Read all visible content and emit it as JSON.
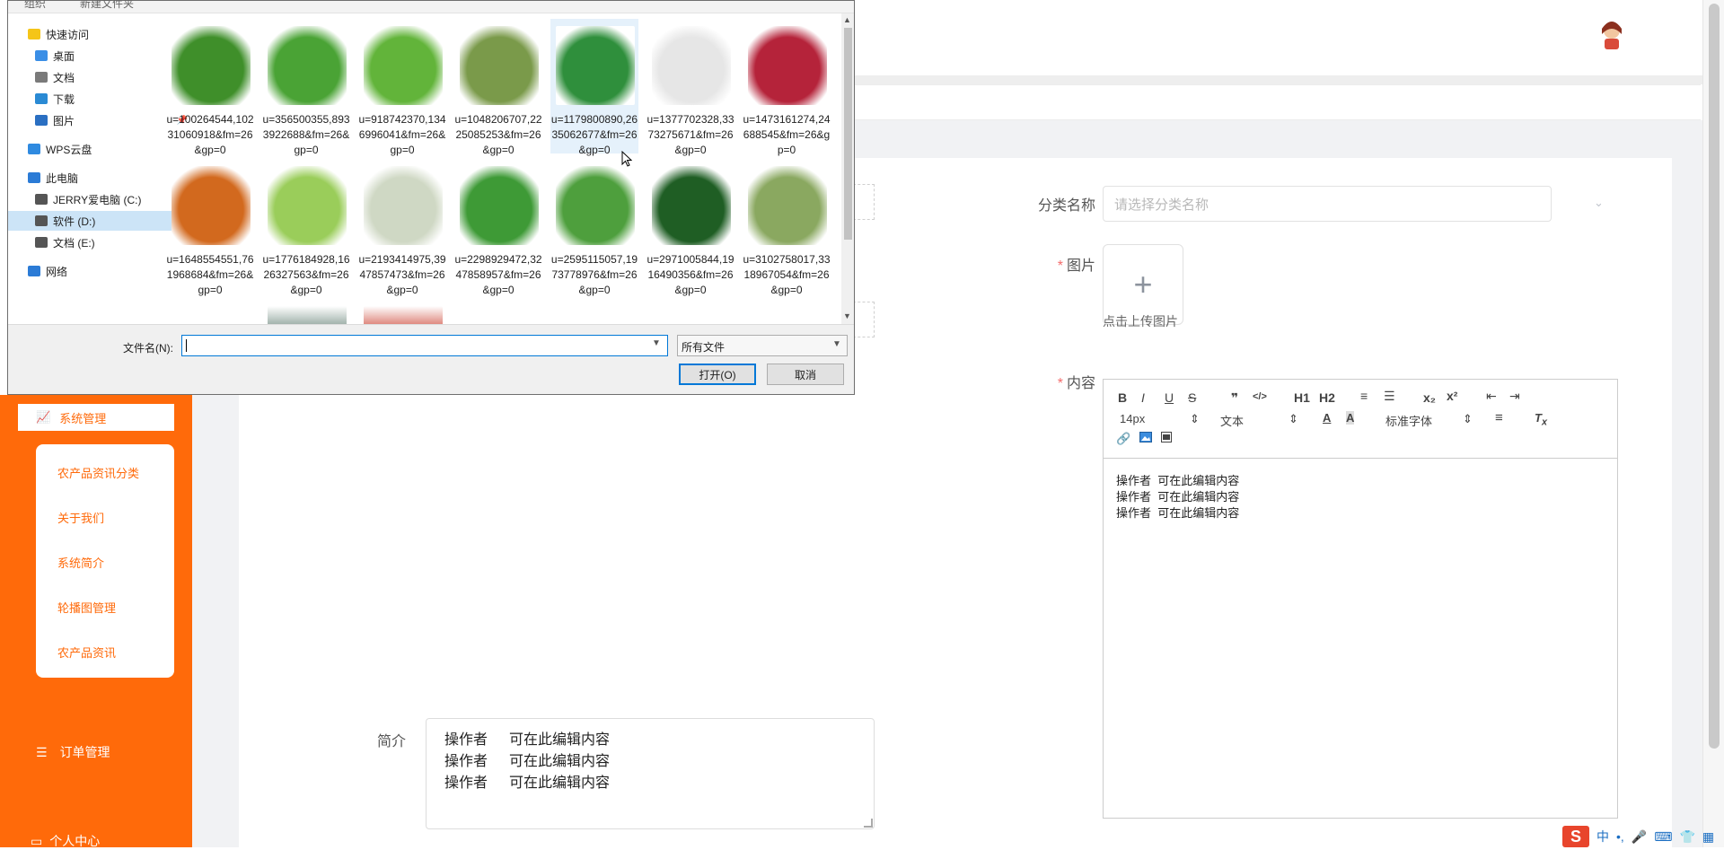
{
  "app": {
    "sidebar": {
      "active_label": "系统管理",
      "submenu": [
        "农产品资讯分类",
        "关于我们",
        "系统简介",
        "轮播图管理",
        "农产品资讯"
      ],
      "order_label": "订单管理",
      "center_label": "个人中心"
    },
    "form": {
      "category_label": "分类名称",
      "category_placeholder": "请选择分类名称",
      "image_label": "图片",
      "upload_plus": "+",
      "upload_tip": "点击上传图片",
      "content_label": "内容",
      "intro_label": "简介",
      "required_mark": "*"
    },
    "editor": {
      "toolbar": [
        "B",
        "I",
        "U",
        "S",
        "❞",
        "</>",
        "H1",
        "H2",
        "≡",
        "☰",
        "x₂",
        "x²",
        "⇤",
        "⇥"
      ],
      "font_size": "14px",
      "text_type": "文本",
      "font_family": "标准字体",
      "lines": [
        {
          "a": "操作者",
          "b": "可在此编辑内容"
        },
        {
          "a": "操作者",
          "b": "可在此编辑内容"
        },
        {
          "a": "操作者",
          "b": "可在此编辑内容"
        }
      ]
    },
    "intro": {
      "lines": [
        {
          "a": "操作者",
          "b": "可在此编辑内容"
        },
        {
          "a": "操作者",
          "b": "可在此编辑内容"
        },
        {
          "a": "操作者",
          "b": "可在此编辑内容"
        }
      ]
    },
    "tray": [
      "中",
      "•,",
      "🎤",
      "⌨",
      "👕",
      "▦"
    ]
  },
  "dialog": {
    "top_items": [
      "组织",
      "新建文件夹"
    ],
    "nav": [
      {
        "label": "快速访问",
        "icon": "star-icon",
        "color": "#f5c518"
      },
      {
        "label": "桌面",
        "icon": "desktop-icon",
        "color": "#3a8ee6",
        "pinned": true
      },
      {
        "label": "文档",
        "icon": "document-icon",
        "color": "#7a7a7a",
        "pinned": true
      },
      {
        "label": "下载",
        "icon": "download-icon",
        "color": "#2a8ad4",
        "pinned": true
      },
      {
        "label": "图片",
        "icon": "picture-icon",
        "color": "#2a6fc2",
        "pinned": true
      },
      {
        "label": "WPS云盘",
        "icon": "cloud-icon",
        "color": "#2f8ae0"
      },
      {
        "label": "此电脑",
        "icon": "computer-icon",
        "color": "#2b7bd6"
      },
      {
        "label": "JERRY爱电脑 (C:)",
        "icon": "drive-icon",
        "color": "#555555"
      },
      {
        "label": "软件 (D:)",
        "icon": "drive-icon",
        "color": "#555555",
        "selected": true
      },
      {
        "label": "文档 (E:)",
        "icon": "drive-icon",
        "color": "#555555"
      },
      {
        "label": "网络",
        "icon": "network-icon",
        "color": "#2b7bd6"
      }
    ],
    "files": [
      {
        "name": "u=100264544,10231060918&fm=26&gp=0",
        "color": "#3f8f2a"
      },
      {
        "name": "u=356500355,8933922688&fm=26&gp=0",
        "color": "#4aa335"
      },
      {
        "name": "u=918742370,1346996041&fm=26&gp=0",
        "color": "#62b43a"
      },
      {
        "name": "u=1048206707,2225085253&fm=26&gp=0",
        "color": "#7a9a4a"
      },
      {
        "name": "u=1179800890,2635062677&fm=26&gp=0",
        "color": "#2f8f3c"
      },
      {
        "name": "u=1377702328,3373275671&fm=26&gp=0",
        "color": "#e6e6e6"
      },
      {
        "name": "u=1473161274,24688545&fm=26&gp=0",
        "color": "#b5233a"
      },
      {
        "name": "u=1648554551,761968684&fm=26&gp=0",
        "color": "#d2691e"
      },
      {
        "name": "u=1776184928,1626327563&fm=26&gp=0",
        "color": "#9acd5a"
      },
      {
        "name": "u=2193414975,3947857473&fm=26&gp=0",
        "color": "#cfd8c4"
      },
      {
        "name": "u=2298929472,3247858957&fm=26&gp=0",
        "color": "#3e9a36"
      },
      {
        "name": "u=2595115057,1973778976&fm=26&gp=0",
        "color": "#4e9f3d"
      },
      {
        "name": "u=2971005844,1916490356&fm=26&gp=0",
        "color": "#1f5e24"
      },
      {
        "name": "u=3102758017,3318967054&fm=26&gp=0",
        "color": "#8aa860"
      }
    ],
    "partial_files": [
      {
        "color": "#5d7a6e"
      },
      {
        "color": "#c73220"
      }
    ],
    "filename_label": "文件名(N):",
    "filename_value": "",
    "filter_label": "所有文件",
    "open_label": "打开(O)",
    "cancel_label": "取消"
  }
}
